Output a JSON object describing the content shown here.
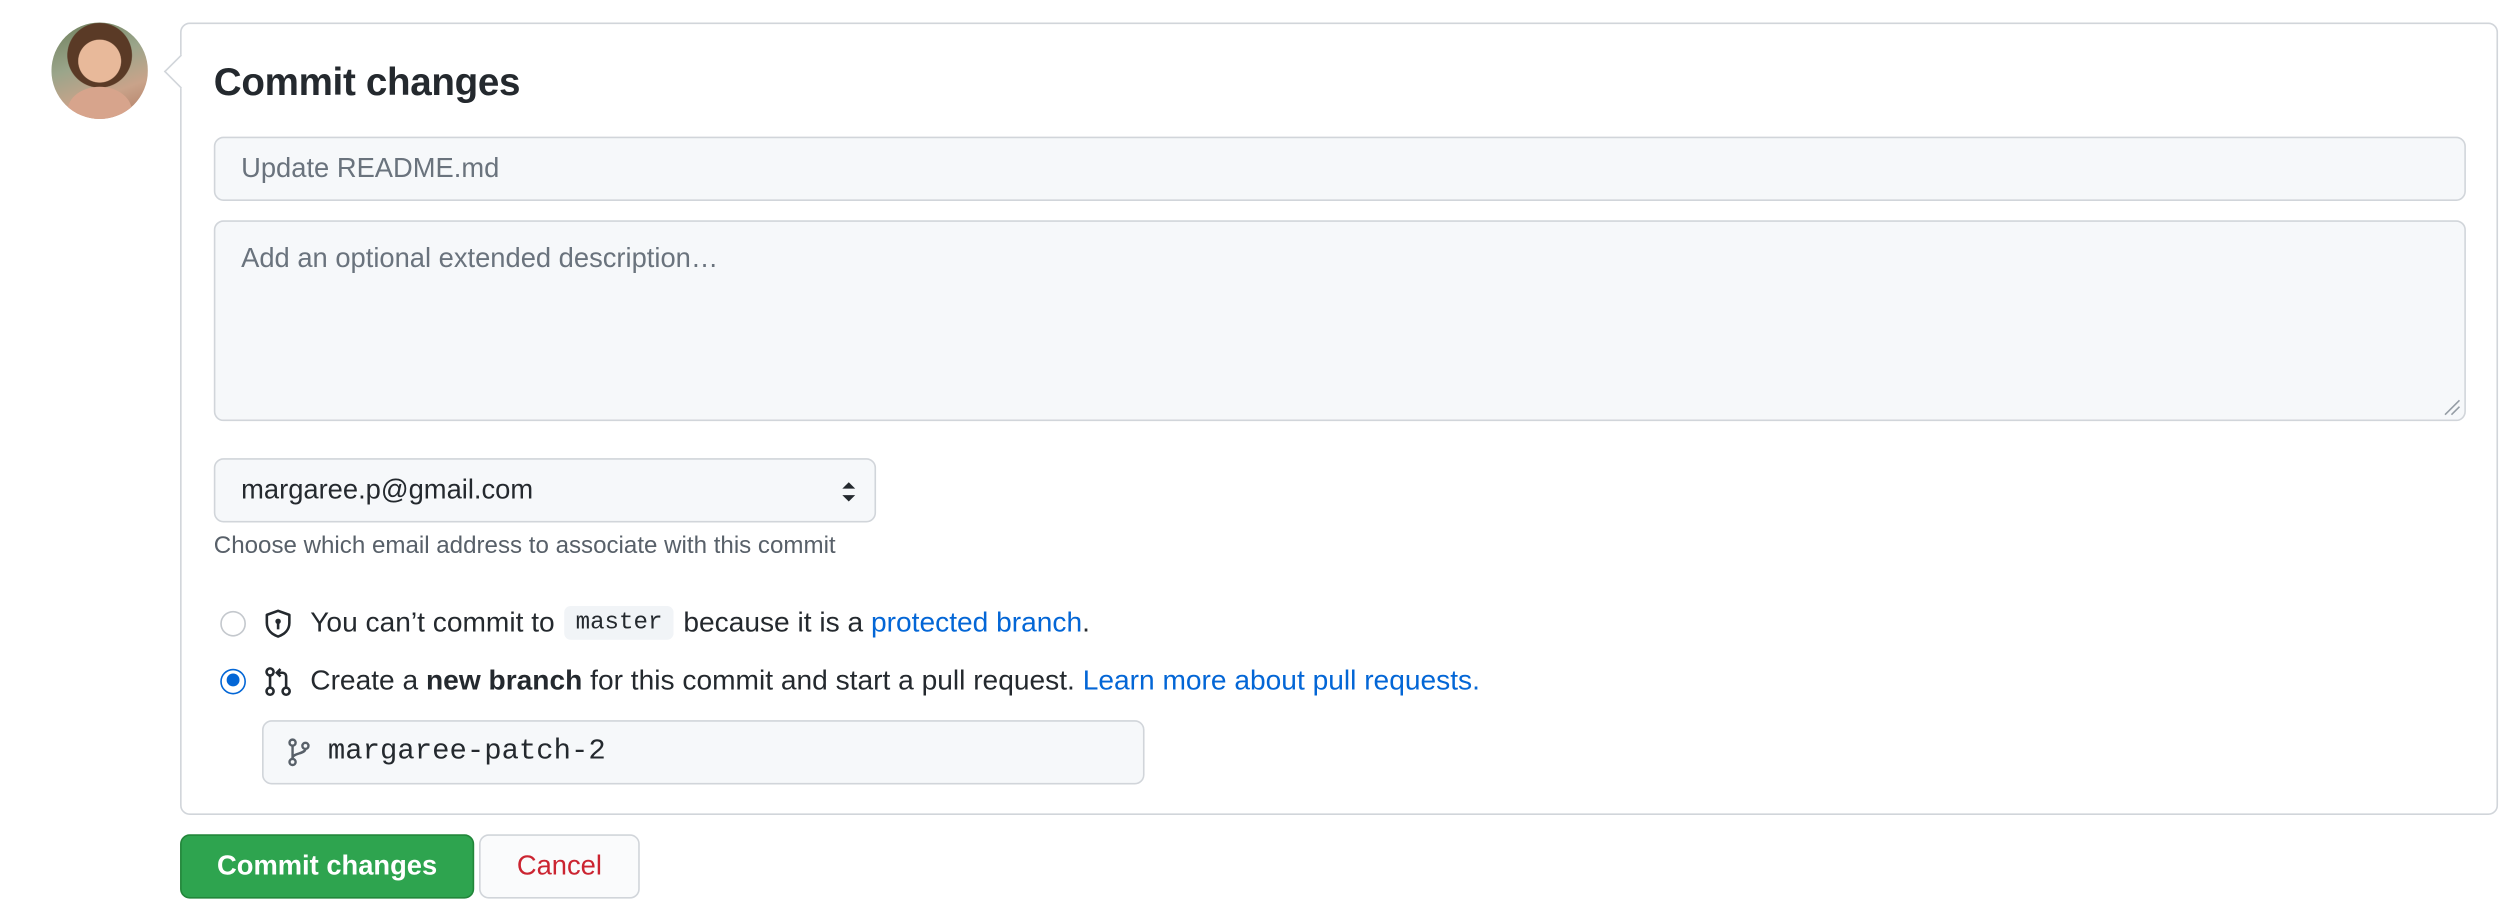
{
  "form": {
    "title": "Commit changes",
    "summary_placeholder": "Update README.md",
    "description_placeholder": "Add an optional extended description…",
    "email_value": "margaree.p@gmail.com",
    "email_hint": "Choose which email address to associate with this commit"
  },
  "options": {
    "protected": {
      "prefix": "You can’t commit to",
      "branch": "master",
      "middle": "because it is a",
      "link": "protected branch",
      "suffix": ".",
      "selected": false
    },
    "new_branch": {
      "prefix": "Create a",
      "bold": "new branch",
      "middle": "for this commit and start a pull request.",
      "link": "Learn more about pull requests.",
      "selected": true
    }
  },
  "branch_name": "margaree-patch-2",
  "buttons": {
    "commit": "Commit changes",
    "cancel": "Cancel"
  },
  "colors": {
    "primary_button": "#2ea44f",
    "link": "#0366d6",
    "danger_text": "#cb2431"
  },
  "icons": [
    "avatar",
    "shield-icon",
    "git-pull-request-icon",
    "git-branch-icon",
    "select-caret-icon"
  ]
}
